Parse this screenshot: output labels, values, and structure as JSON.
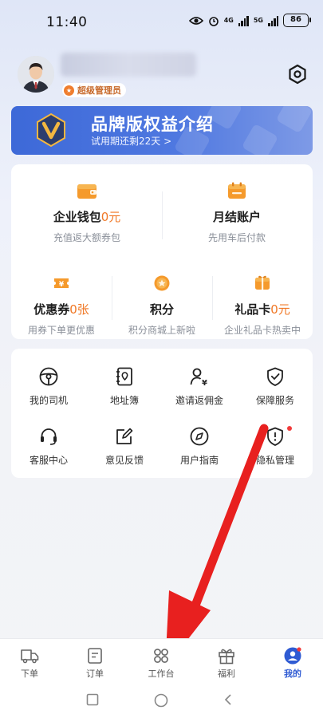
{
  "status_bar": {
    "time": "11:40",
    "network_1": "4G",
    "network_2": "5G",
    "battery": "86"
  },
  "profile": {
    "role": "超级管理员",
    "settings_icon": "gear-hexagon-icon"
  },
  "brand_banner": {
    "title": "品牌版权益介绍",
    "subtitle": "试用期还剩22天 >"
  },
  "wallet_section": {
    "enterprise_wallet": {
      "title": "企业钱包",
      "value": "0元",
      "subtitle": "充值返大额券包",
      "icon": "wallet-icon"
    },
    "monthly_account": {
      "title": "月结账户",
      "subtitle": "先用车后付款",
      "icon": "calendar-icon"
    },
    "coupons": {
      "title": "优惠券",
      "value": "0张",
      "subtitle": "用券下单更优惠",
      "icon": "coupon-icon"
    },
    "points": {
      "title": "积分",
      "subtitle": "积分商城上新啦",
      "icon": "points-icon"
    },
    "gift_card": {
      "title": "礼品卡",
      "value": "0元",
      "subtitle": "企业礼品卡热卖中",
      "icon": "gift-card-icon"
    }
  },
  "services": [
    {
      "label": "我的司机",
      "icon": "steering-wheel-icon"
    },
    {
      "label": "地址簿",
      "icon": "address-book-icon"
    },
    {
      "label": "邀请返佣金",
      "icon": "invite-commission-icon"
    },
    {
      "label": "保障服务",
      "icon": "shield-check-icon"
    },
    {
      "label": "客服中心",
      "icon": "headset-icon"
    },
    {
      "label": "意见反馈",
      "icon": "feedback-icon"
    },
    {
      "label": "用户指南",
      "icon": "compass-icon"
    },
    {
      "label": "隐私管理",
      "icon": "privacy-icon"
    }
  ],
  "bottom_nav": [
    {
      "label": "下单",
      "icon": "truck-icon"
    },
    {
      "label": "订单",
      "icon": "order-icon"
    },
    {
      "label": "工作台",
      "icon": "workbench-icon"
    },
    {
      "label": "福利",
      "icon": "gift-icon"
    },
    {
      "label": "我的",
      "icon": "profile-icon",
      "active": true
    }
  ],
  "colors": {
    "accent": "#2f5bd3",
    "value_orange": "#f07826",
    "arrow_red": "#e8201f",
    "banner_blue": "#3d69d8"
  }
}
